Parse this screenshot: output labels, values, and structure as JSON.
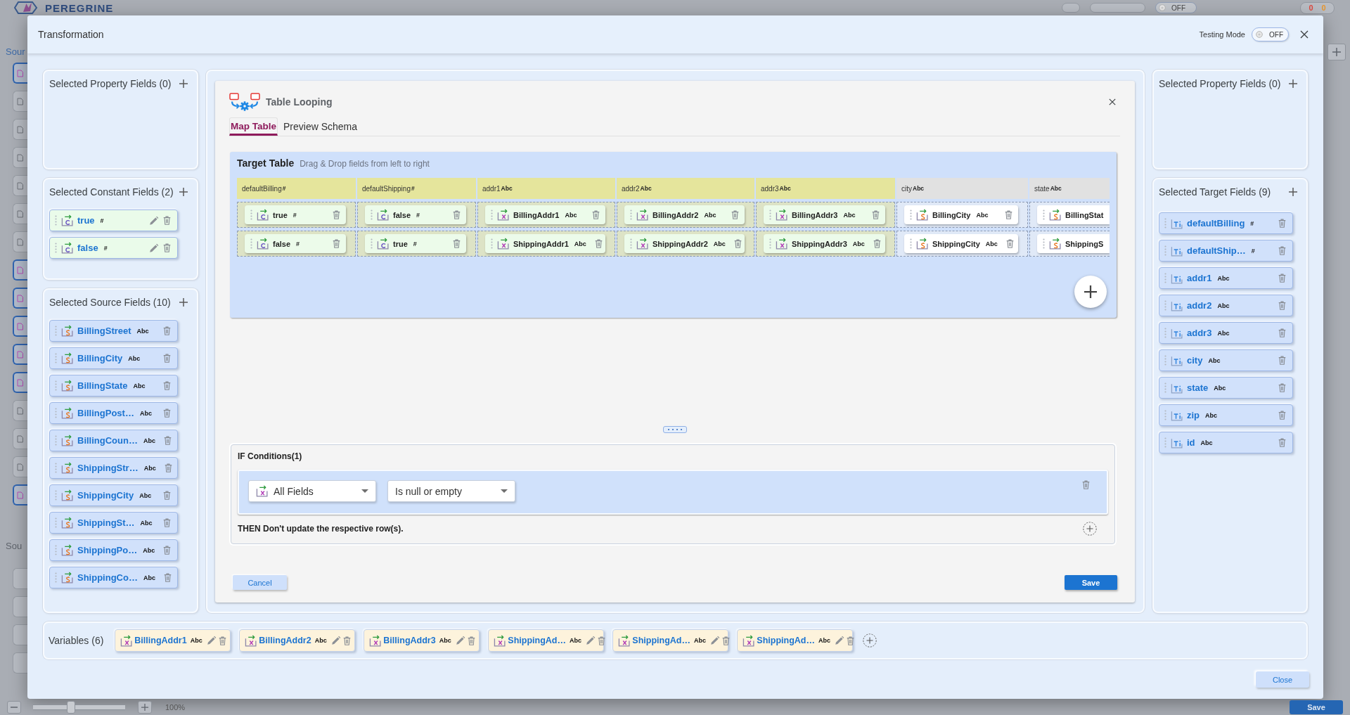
{
  "app": {
    "logo": "PEREGRINE",
    "header_toggle": {
      "label": "OFF",
      "on": false
    },
    "header_counts": [
      {
        "text": "0",
        "color": "#e0483e"
      },
      {
        "text": "0",
        "color": "#e8962e"
      }
    ],
    "section_label": "Sour",
    "side_items": [
      {
        "highlighted": true
      },
      {
        "highlighted": false
      },
      {
        "highlighted": false
      },
      {
        "highlighted": false
      },
      {
        "highlighted": false
      },
      {
        "highlighted": false
      },
      {
        "highlighted": false
      },
      {
        "highlighted": true
      },
      {
        "highlighted": true
      },
      {
        "highlighted": true
      },
      {
        "highlighted": true
      },
      {
        "highlighted": true
      },
      {
        "highlighted": false
      },
      {
        "highlighted": false
      },
      {
        "highlighted": false
      },
      {
        "highlighted": true
      }
    ],
    "lower_section_label": "Sou",
    "zoom": {
      "level": 0.4,
      "reading": "100%"
    },
    "save_button": "Save"
  },
  "dialog": {
    "title": "Transformation",
    "testing_mode": {
      "label": "Testing Mode",
      "state": "OFF",
      "on": false
    },
    "close_button": "Close"
  },
  "left_panels": [
    {
      "title": "Selected Property Fields (0)"
    },
    {
      "title": "Selected Constant Fields (2)",
      "fields": [
        {
          "name": "true",
          "type": "#",
          "kind": "constant",
          "editable": true,
          "deletable": true
        },
        {
          "name": "false",
          "type": "#",
          "kind": "constant",
          "editable": true,
          "deletable": true
        }
      ]
    },
    {
      "title": "Selected Source Fields (10)",
      "fields": [
        {
          "name": "BillingStreet",
          "type": "Abc",
          "kind": "source",
          "editable": false,
          "deletable": true
        },
        {
          "name": "BillingCity",
          "type": "Abc",
          "kind": "source",
          "editable": false,
          "deletable": true
        },
        {
          "name": "BillingState",
          "type": "Abc",
          "kind": "source",
          "editable": false,
          "deletable": true
        },
        {
          "name": "BillingPost…",
          "type": "Abc",
          "kind": "source",
          "editable": false,
          "deletable": true
        },
        {
          "name": "BillingCoun…",
          "type": "Abc",
          "kind": "source",
          "editable": false,
          "deletable": true
        },
        {
          "name": "ShippingStr…",
          "type": "Abc",
          "kind": "source",
          "editable": false,
          "deletable": true
        },
        {
          "name": "ShippingCity",
          "type": "Abc",
          "kind": "source",
          "editable": false,
          "deletable": true
        },
        {
          "name": "ShippingSt…",
          "type": "Abc",
          "kind": "source",
          "editable": false,
          "deletable": true
        },
        {
          "name": "ShippingPo…",
          "type": "Abc",
          "kind": "source",
          "editable": false,
          "deletable": true
        },
        {
          "name": "ShippingCo…",
          "type": "Abc",
          "kind": "source",
          "editable": false,
          "deletable": true
        }
      ]
    }
  ],
  "table_looping": {
    "title": "Table Looping",
    "tabs": [
      {
        "label": "Map Table",
        "selected": true
      },
      {
        "label": "Preview Schema",
        "selected": false
      }
    ],
    "target_table": {
      "title": "Target Table",
      "hint": "Drag & Drop fields from left to right",
      "columns": [
        {
          "name": "defaultBilling",
          "type": "#",
          "highlighted": true
        },
        {
          "name": "defaultShipping",
          "type": "#",
          "highlighted": true
        },
        {
          "name": "addr1",
          "type": "Abc",
          "highlighted": true
        },
        {
          "name": "addr2",
          "type": "Abc",
          "highlighted": true
        },
        {
          "name": "addr3",
          "type": "Abc",
          "highlighted": true
        },
        {
          "name": "city",
          "type": "Abc",
          "highlighted": false
        },
        {
          "name": "state",
          "type": "Abc",
          "highlighted": false
        }
      ],
      "rows": [
        [
          {
            "name": "true",
            "type": "#",
            "kind": "constant",
            "editable": false,
            "deletable": true
          },
          {
            "name": "false",
            "type": "#",
            "kind": "constant",
            "editable": false,
            "deletable": true
          },
          {
            "name": "BillingAddr1",
            "type": "Abc",
            "kind": "variable",
            "editable": false,
            "deletable": true
          },
          {
            "name": "BillingAddr2",
            "type": "Abc",
            "kind": "variable",
            "editable": false,
            "deletable": true
          },
          {
            "name": "BillingAddr3",
            "type": "Abc",
            "kind": "variable",
            "editable": false,
            "deletable": true
          },
          {
            "name": "BillingCity",
            "type": "Abc",
            "kind": "source",
            "editable": false,
            "deletable": true
          },
          {
            "name": "BillingStat",
            "kind": "source",
            "editable": false,
            "deletable": false
          }
        ],
        [
          {
            "name": "false",
            "type": "#",
            "kind": "constant",
            "editable": false,
            "deletable": true
          },
          {
            "name": "true",
            "type": "#",
            "kind": "constant",
            "editable": false,
            "deletable": true
          },
          {
            "name": "ShippingAddr1",
            "type": "Abc",
            "kind": "variable",
            "editable": false,
            "deletable": true
          },
          {
            "name": "ShippingAddr2",
            "type": "Abc",
            "kind": "variable",
            "editable": false,
            "deletable": true
          },
          {
            "name": "ShippingAddr3",
            "type": "Abc",
            "kind": "variable",
            "editable": false,
            "deletable": true
          },
          {
            "name": "ShippingCity",
            "type": "Abc",
            "kind": "source",
            "editable": false,
            "deletable": true
          },
          {
            "name": "ShippingS",
            "kind": "source",
            "editable": false,
            "deletable": false
          }
        ]
      ]
    },
    "if_conditions": {
      "title": "IF Conditions(1)",
      "conditions": [
        {
          "field": {
            "label": "All Fields",
            "kind": "variable"
          },
          "operator": "Is null or empty"
        }
      ],
      "then": "THEN Don't update the respective row(s)."
    },
    "cancel_button": "Cancel",
    "save_button": "Save"
  },
  "right_panels": [
    {
      "title": "Selected Property Fields (0)"
    },
    {
      "title": "Selected Target Fields (9)",
      "fields": [
        {
          "name": "defaultBilling",
          "type": "#",
          "kind": "target",
          "editable": false,
          "deletable": true
        },
        {
          "name": "defaultShip…",
          "type": "#",
          "kind": "target",
          "editable": false,
          "deletable": true
        },
        {
          "name": "addr1",
          "type": "Abc",
          "kind": "target",
          "editable": false,
          "deletable": true
        },
        {
          "name": "addr2",
          "type": "Abc",
          "kind": "target",
          "editable": false,
          "deletable": true
        },
        {
          "name": "addr3",
          "type": "Abc",
          "kind": "target",
          "editable": false,
          "deletable": true
        },
        {
          "name": "city",
          "type": "Abc",
          "kind": "target",
          "editable": false,
          "deletable": true
        },
        {
          "name": "state",
          "type": "Abc",
          "kind": "target",
          "editable": false,
          "deletable": true
        },
        {
          "name": "zip",
          "type": "Abc",
          "kind": "target",
          "editable": false,
          "deletable": true
        },
        {
          "name": "id",
          "type": "Abc",
          "kind": "target",
          "editable": false,
          "deletable": true
        }
      ]
    }
  ],
  "variables": {
    "title": "Variables (6)",
    "fields": [
      {
        "name": "BillingAddr1",
        "type": "Abc",
        "kind": "variable",
        "editable": true,
        "deletable": true
      },
      {
        "name": "BillingAddr2",
        "type": "Abc",
        "kind": "variable",
        "editable": true,
        "deletable": true
      },
      {
        "name": "BillingAddr3",
        "type": "Abc",
        "kind": "variable",
        "editable": true,
        "deletable": true
      },
      {
        "name": "ShippingAd…",
        "type": "Abc",
        "kind": "variable",
        "editable": true,
        "deletable": true
      },
      {
        "name": "ShippingAd…",
        "type": "Abc",
        "kind": "variable",
        "editable": true,
        "deletable": true
      },
      {
        "name": "ShippingAd…",
        "type": "Abc",
        "kind": "variable",
        "editable": true,
        "deletable": true
      }
    ]
  }
}
